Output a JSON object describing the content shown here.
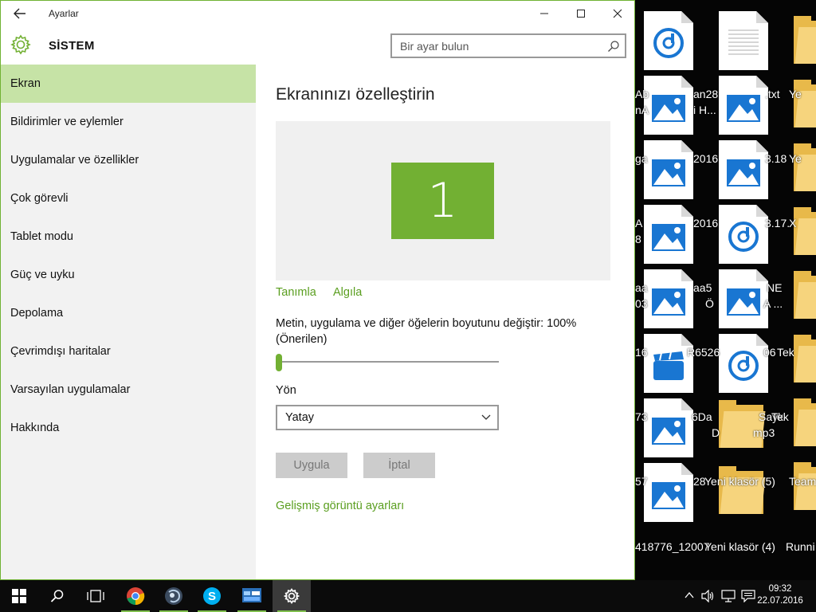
{
  "window": {
    "title": "Ayarlar",
    "section_title": "SİSTEM",
    "search_placeholder": "Bir ayar bulun"
  },
  "sidebar": {
    "items": [
      {
        "label": "Ekran",
        "active": true
      },
      {
        "label": "Bildirimler ve eylemler"
      },
      {
        "label": "Uygulamalar ve özellikler"
      },
      {
        "label": "Çok görevli"
      },
      {
        "label": "Tablet modu"
      },
      {
        "label": "Güç ve uyku"
      },
      {
        "label": "Depolama"
      },
      {
        "label": "Çevrimdışı haritalar"
      },
      {
        "label": "Varsayılan uygulamalar"
      },
      {
        "label": "Hakkında"
      }
    ]
  },
  "main": {
    "page_title": "Ekranınızı özelleştirin",
    "monitor_number": "1",
    "identify_link": "Tanımla",
    "detect_link": "Algıla",
    "scale_label": "Metin, uygulama ve diğer öğelerin boyutunu değiştir: 100% (Önerilen)",
    "scale_value_percent": 100,
    "orientation_label": "Yön",
    "orientation_value": "Yatay",
    "apply_button": "Uygula",
    "cancel_button": "İptal",
    "advanced_link": "Gelişmiş görüntü ayarları"
  },
  "desktop": {
    "labels": [
      "Ab",
      "an28",
      ".txt",
      "Ye",
      "nA",
      "i H...",
      "ga",
      "2016",
      "3.18",
      "Ye",
      "A",
      "2016",
      "3.17.",
      "X",
      "8",
      "aa",
      "aa5",
      "NE",
      "03",
      "Ö",
      "A ...",
      "16",
      "R6526",
      "06",
      "Tek",
      "73",
      "6Da",
      "Sayk",
      "Tek",
      "D",
      "mp3",
      "57",
      "28",
      "Yeni klasör (5)",
      "Team",
      "418776_12007",
      "Yeni klasör (4)",
      "Runni"
    ]
  },
  "taskbar": {
    "time": "09:32",
    "date": "22.07.2016"
  },
  "colors": {
    "accent": "#72b033",
    "active_nav": "#c6e3a6",
    "link": "#5a9e1f",
    "file_icon_blue": "#1976d2",
    "folder_yellow": "#f6d47d"
  }
}
